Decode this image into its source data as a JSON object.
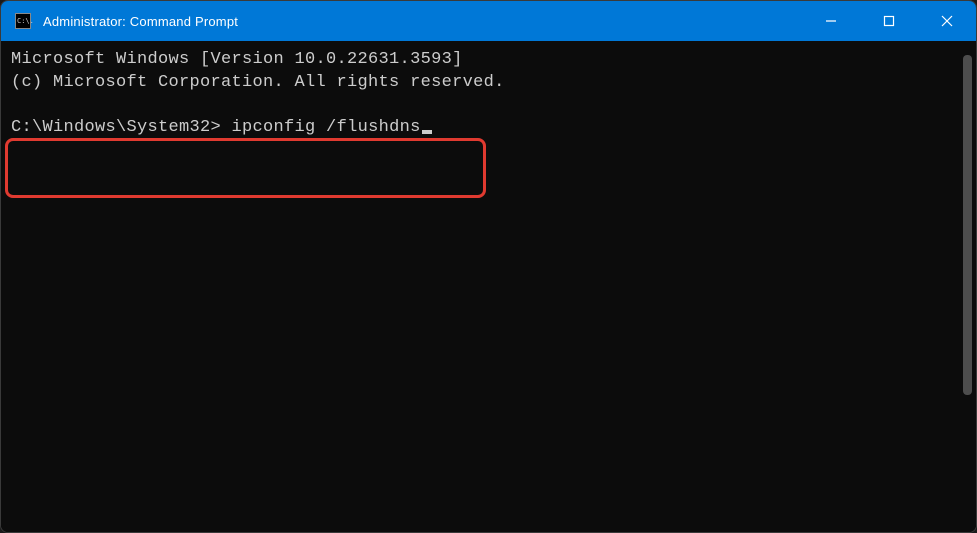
{
  "window": {
    "title": "Administrator: Command Prompt",
    "icon_glyph": "C:\\."
  },
  "terminal": {
    "line1": "Microsoft Windows [Version 10.0.22631.3593]",
    "line2": "(c) Microsoft Corporation. All rights reserved.",
    "prompt": "C:\\Windows\\System32> ",
    "command": "ipconfig /flushdns"
  }
}
